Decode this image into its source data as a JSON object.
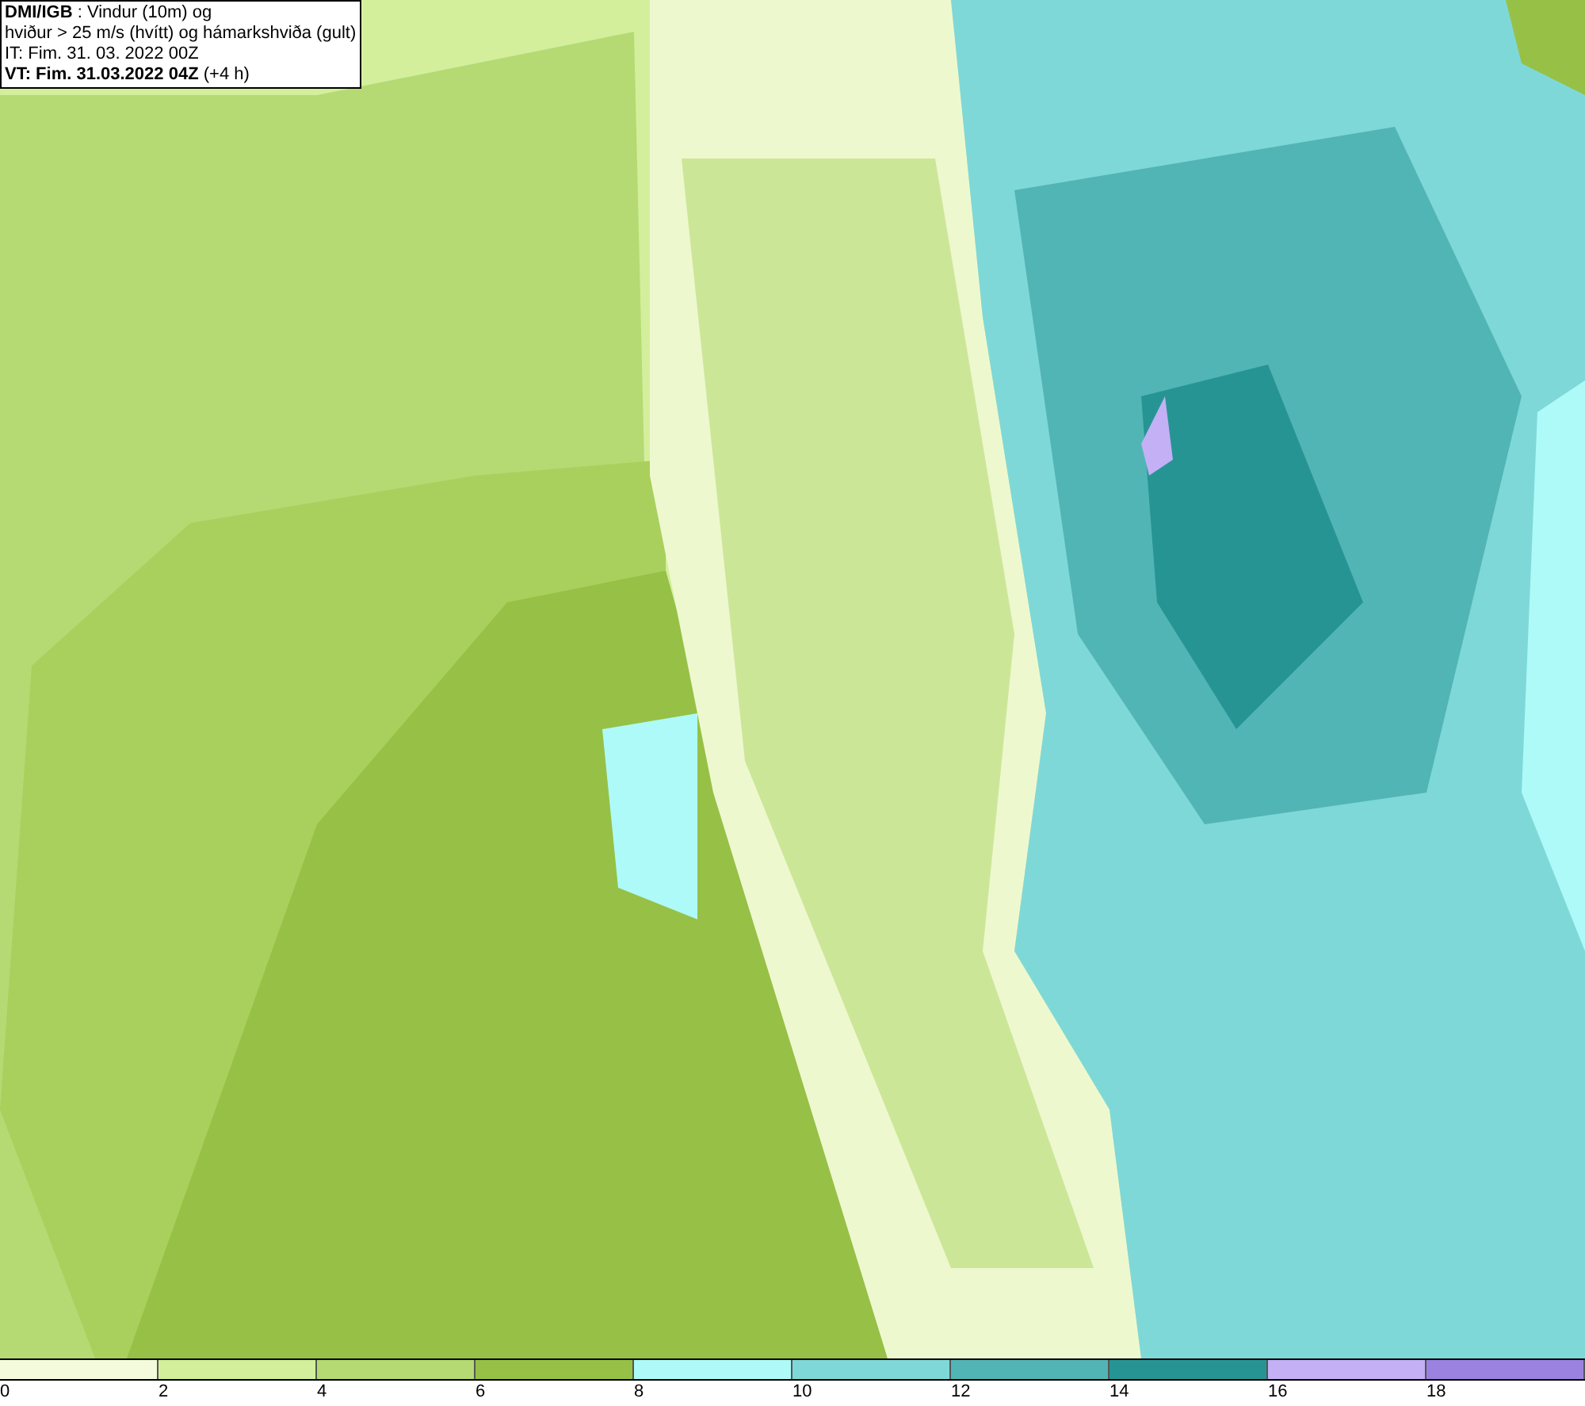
{
  "header": {
    "lines": [
      "**DMI/IGB** : Vindur (10m) og",
      "hviður > 25 m/s (hvítt) og hámarkshviða (gult)",
      "IT: Fim. 31. 03. 2022 00Z",
      "**VT: Fim. 31.03.2022 04Z** (+4 h)"
    ]
  },
  "legend": {
    "segments": [
      {
        "label": "0",
        "color": "#f4fbdc"
      },
      {
        "label": "2",
        "color": "#d3ef9c"
      },
      {
        "label": "4",
        "color": "#b5da73"
      },
      {
        "label": "6",
        "color": "#97c046"
      },
      {
        "label": "8",
        "color": "#aefaf8"
      },
      {
        "label": "10",
        "color": "#7fd8d8"
      },
      {
        "label": "12",
        "color": "#52b5b5"
      },
      {
        "label": "14",
        "color": "#279494"
      },
      {
        "label": "16",
        "color": "#c3b0f5"
      },
      {
        "label": "18",
        "color": "#9b82e0"
      }
    ]
  }
}
